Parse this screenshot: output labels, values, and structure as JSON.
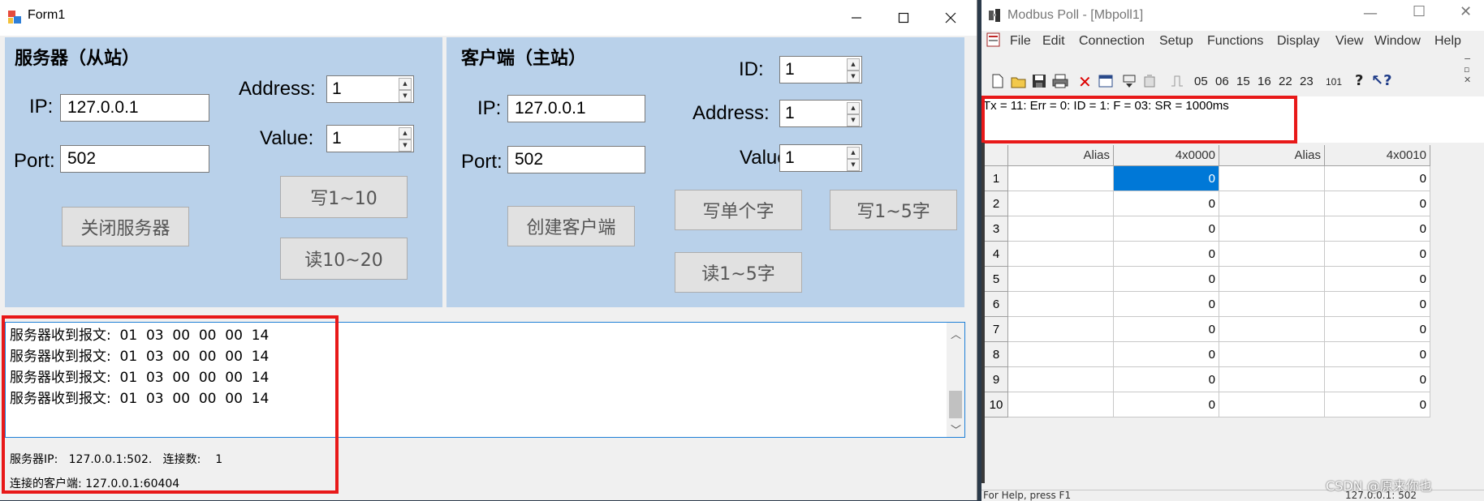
{
  "form1": {
    "title": "Form1",
    "server": {
      "title": "服务器（从站）",
      "ip_label": "IP:",
      "ip_value": "127.0.0.1",
      "port_label": "Port:",
      "port_value": "502",
      "address_label": "Address:",
      "address_value": "1",
      "value_label": "Value:",
      "value_value": "1",
      "write_button": "写1~10",
      "read_button": "读10~20",
      "close_button": "关闭服务器"
    },
    "client": {
      "title": "客户端（主站）",
      "ip_label": "IP:",
      "ip_value": "127.0.0.1",
      "port_label": "Port:",
      "port_value": "502",
      "id_label": "ID:",
      "id_value": "1",
      "address_label": "Address:",
      "address_value": "1",
      "value_label": "Value:",
      "value_value": "1",
      "create_button": "创建客户端",
      "write_single_button": "写单个字",
      "write_multi_button": "写1~5字",
      "read_button": "读1~5字"
    },
    "log": [
      "服务器收到报文:  01  03  00  00  00  14",
      "服务器收到报文:  01  03  00  00  00  14",
      "服务器收到报文:  01  03  00  00  00  14",
      "服务器收到报文:  01  03  00  00  00  14"
    ],
    "status_server": "服务器IP:   127.0.0.1:502.   连接数:    1",
    "status_client": "连接的客户端: 127.0.0.1:60404"
  },
  "modbus_poll": {
    "title": "Modbus Poll - [Mbpoll1]",
    "menu": [
      "File",
      "Edit",
      "Connection",
      "Setup",
      "Functions",
      "Display",
      "View",
      "Window",
      "Help"
    ],
    "toolbar_codes": [
      "05",
      "06",
      "15",
      "16",
      "22",
      "23",
      "101"
    ],
    "status_line": "Tx = 11: Err = 0: ID = 1: F = 03: SR = 1000ms",
    "columns": [
      "Alias",
      "4x0000",
      "Alias",
      "4x0010"
    ],
    "rows": [
      {
        "n": "1",
        "v1": "0",
        "v2": "0"
      },
      {
        "n": "2",
        "v1": "0",
        "v2": "0"
      },
      {
        "n": "3",
        "v1": "0",
        "v2": "0"
      },
      {
        "n": "4",
        "v1": "0",
        "v2": "0"
      },
      {
        "n": "5",
        "v1": "0",
        "v2": "0"
      },
      {
        "n": "6",
        "v1": "0",
        "v2": "0"
      },
      {
        "n": "7",
        "v1": "0",
        "v2": "0"
      },
      {
        "n": "8",
        "v1": "0",
        "v2": "0"
      },
      {
        "n": "9",
        "v1": "0",
        "v2": "0"
      },
      {
        "n": "10",
        "v1": "0",
        "v2": "0"
      }
    ],
    "bottom_status_left": "For Help, press F1",
    "bottom_status_right": "127.0.0.1: 502"
  },
  "watermark": "CSDN @原来你也",
  "colors": {
    "panel": "#b9d1ea",
    "highlight": "#e81919",
    "selection": "#0078d7"
  }
}
